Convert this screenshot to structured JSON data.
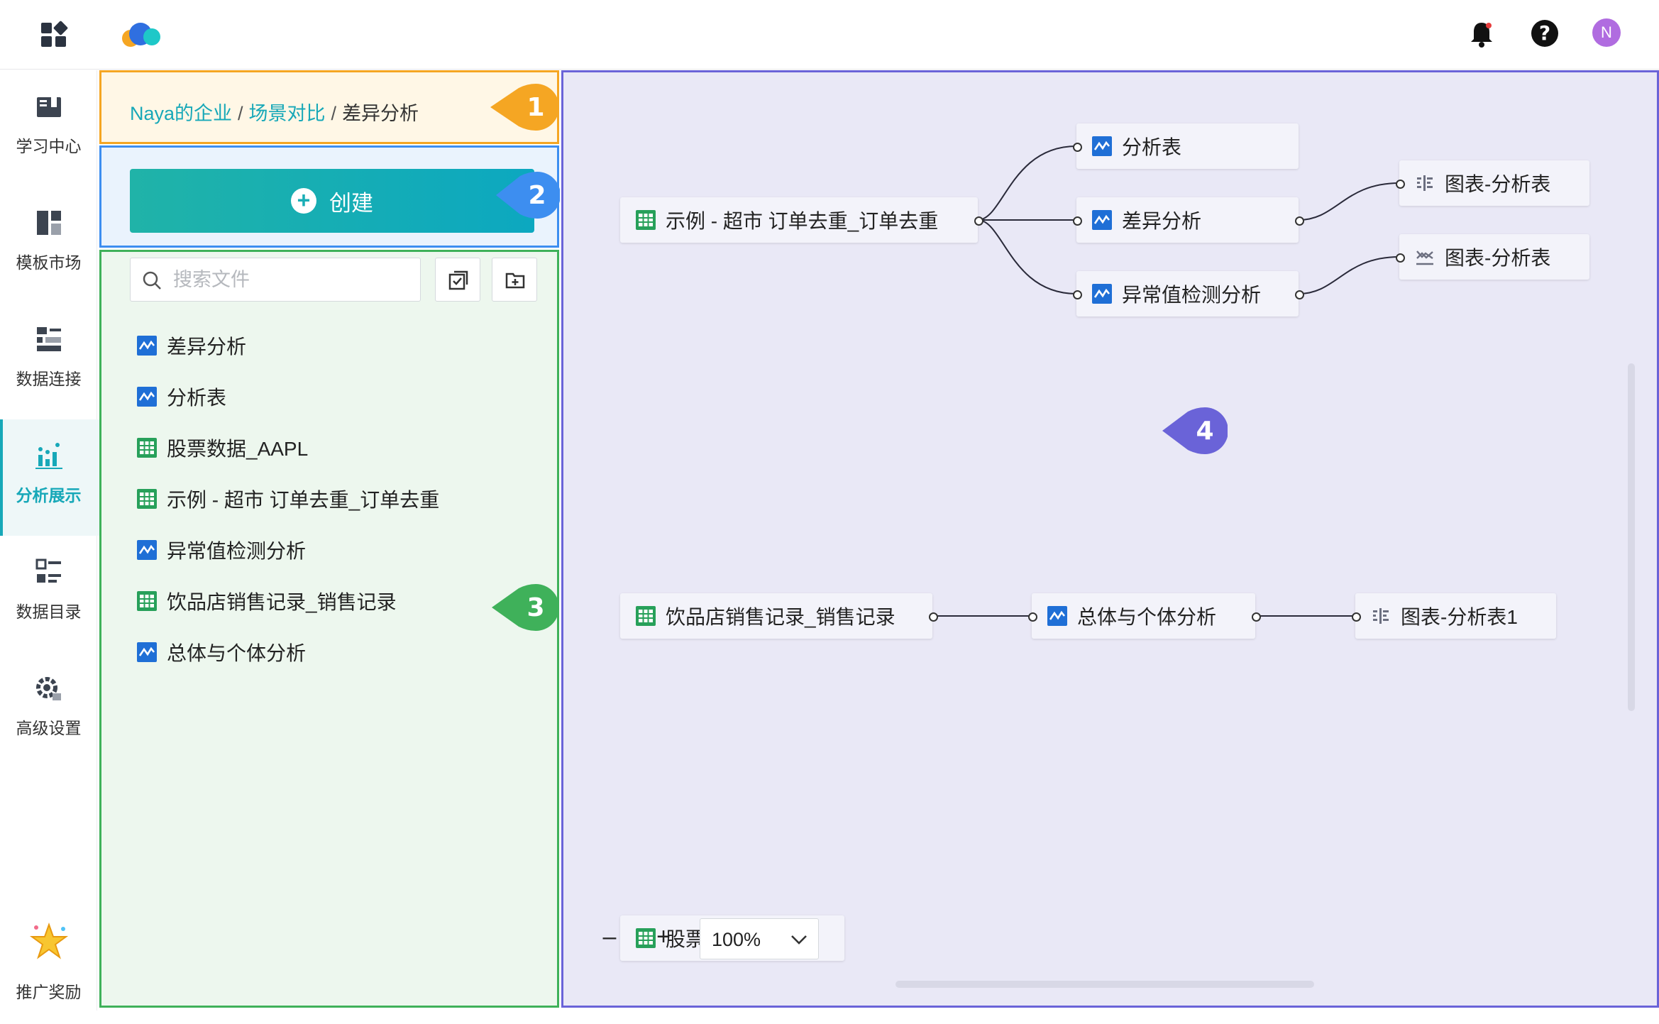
{
  "colors": {
    "accent": "#17a8b8",
    "callout1": "#f5a623",
    "callout2": "#3d8ef0",
    "callout3": "#3fb15a",
    "callout4": "#6a63d8"
  },
  "topbar": {
    "avatar_initial": "N"
  },
  "nav": {
    "items": [
      {
        "label": "学习中心",
        "icon": "book-icon"
      },
      {
        "label": "模板市场",
        "icon": "template-icon"
      },
      {
        "label": "数据连接",
        "icon": "data-connect-icon"
      },
      {
        "label": "分析展示",
        "icon": "analysis-chart-icon",
        "active": true
      },
      {
        "label": "数据目录",
        "icon": "catalog-list-icon"
      },
      {
        "label": "高级设置",
        "icon": "gear-icon"
      },
      {
        "label": "推广奖励",
        "icon": "star-reward-icon"
      }
    ]
  },
  "breadcrumb": {
    "org": "Naya的企业",
    "project": "场景对比",
    "current": "差异分析",
    "sep": "/"
  },
  "create": {
    "label": "创建"
  },
  "search": {
    "placeholder": "搜索文件"
  },
  "files": [
    {
      "name": "差异分析",
      "type": "analysis"
    },
    {
      "name": "分析表",
      "type": "analysis"
    },
    {
      "name": "股票数据_AAPL",
      "type": "table"
    },
    {
      "name": "示例 - 超市 订单去重_订单去重",
      "type": "table"
    },
    {
      "name": "异常值检测分析",
      "type": "analysis"
    },
    {
      "name": "饮品店销售记录_销售记录",
      "type": "table"
    },
    {
      "name": "总体与个体分析",
      "type": "analysis"
    }
  ],
  "canvas": {
    "nodes": {
      "src1": "示例 - 超市 订单去重_订单去重",
      "a1": "分析表",
      "a2": "差异分析",
      "a3": "异常值检测分析",
      "c1": "图表-分析表",
      "c2": "图表-分析表",
      "src2": "饮品店销售记录_销售记录",
      "a4": "总体与个体分析",
      "c3": "图表-分析表1",
      "src3": "股票"
    },
    "zoom": "100%"
  },
  "callouts": [
    "1",
    "2",
    "3",
    "4"
  ]
}
